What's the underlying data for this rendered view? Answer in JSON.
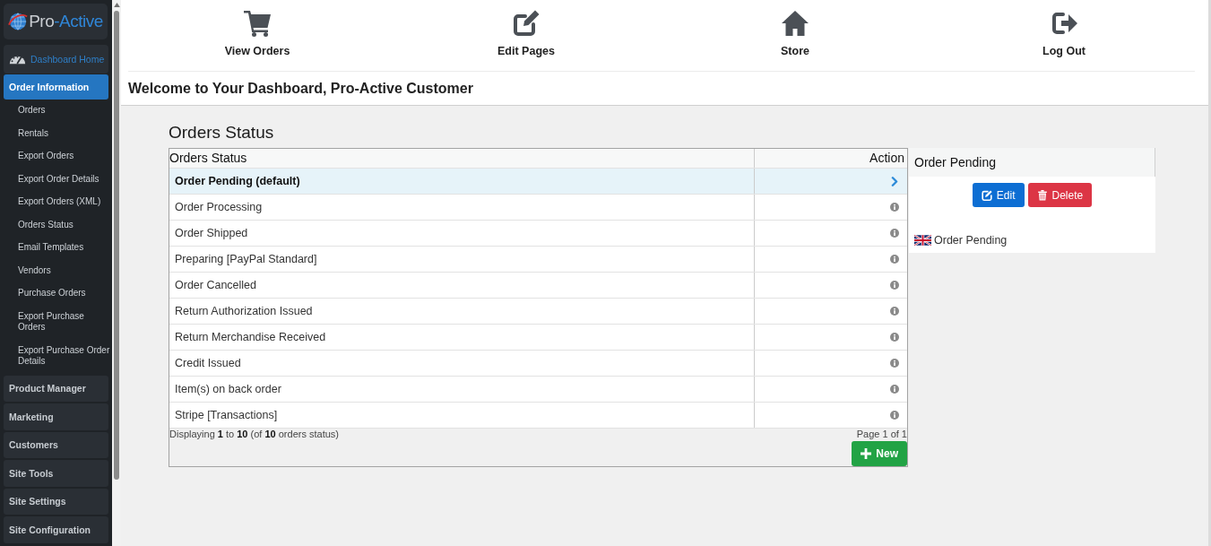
{
  "sidebar": {
    "logo": {
      "parts": [
        "Pro",
        "-Active"
      ]
    },
    "home": {
      "label": "Dashboard Home"
    },
    "sections": [
      {
        "label": "Order Information",
        "expanded": true,
        "children": [
          {
            "label": "Orders"
          },
          {
            "label": "Rentals"
          },
          {
            "label": "Export Orders"
          },
          {
            "label": "Export Order Details"
          },
          {
            "label": "Export Orders (XML)"
          },
          {
            "label": "Orders Status"
          },
          {
            "label": "Email Templates"
          },
          {
            "label": "Vendors"
          },
          {
            "label": "Purchase Orders"
          },
          {
            "label": "Export Purchase Orders"
          },
          {
            "label": "Export Purchase Order Details"
          }
        ]
      },
      {
        "label": "Product Manager",
        "expanded": false
      },
      {
        "label": "Marketing",
        "expanded": false
      },
      {
        "label": "Customers",
        "expanded": false
      },
      {
        "label": "Site Tools",
        "expanded": false
      },
      {
        "label": "Site Settings",
        "expanded": false
      },
      {
        "label": "Site Configuration",
        "expanded": false
      }
    ]
  },
  "top_nav": [
    {
      "label": "View Orders",
      "kind": "cart"
    },
    {
      "label": "Edit Pages",
      "kind": "edit"
    },
    {
      "label": "Store",
      "kind": "home"
    },
    {
      "label": "Log Out",
      "kind": "logout"
    }
  ],
  "welcome": "Welcome to Your Dashboard, Pro-Active Customer",
  "page_title": "Orders Status",
  "table": {
    "columns": [
      "Orders Status",
      "Action"
    ],
    "rows": [
      {
        "name": "Order Pending (default)",
        "selected": true
      },
      {
        "name": "Order Processing",
        "selected": false
      },
      {
        "name": "Order Shipped",
        "selected": false
      },
      {
        "name": "Preparing [PayPal Standard]",
        "selected": false
      },
      {
        "name": "Order Cancelled",
        "selected": false
      },
      {
        "name": "Return Authorization Issued",
        "selected": false
      },
      {
        "name": "Return Merchandise Received",
        "selected": false
      },
      {
        "name": "Credit Issued",
        "selected": false
      },
      {
        "name": "Item(s) on back order",
        "selected": false
      },
      {
        "name": "Stripe [Transactions]",
        "selected": false
      }
    ],
    "footer": "Displaying **1** to **10** (of **10** orders status)",
    "pagination": "Page 1 of 1",
    "new_button": {
      "label": "New"
    }
  },
  "detail": {
    "title": "Order Pending",
    "buttons": [
      {
        "label": "Edit",
        "kind": "edit"
      },
      {
        "label": "Delete",
        "kind": "delete"
      }
    ],
    "languages": [
      {
        "name": "Order Pending"
      }
    ]
  }
}
